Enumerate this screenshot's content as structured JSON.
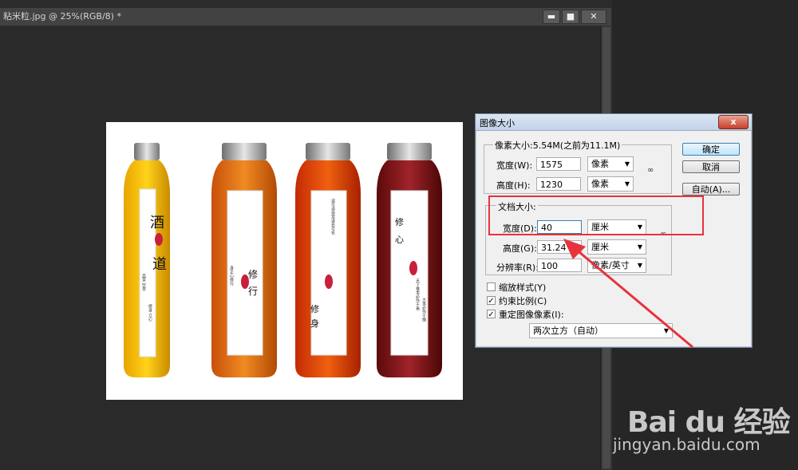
{
  "window": {
    "title": "粘米粒.jpg @ 25%(RGB/8) *",
    "min_label": "▬",
    "max_label": "■",
    "close_label": "✕"
  },
  "bottles": [
    {
      "big_chars": [
        "酒",
        "道"
      ],
      "small_lines": [
        "品茶 饮茶",
        "修身 立心"
      ]
    },
    {
      "big_chars": [
        "修",
        "行"
      ],
      "small_lines": [
        "身正心修行"
      ]
    },
    {
      "big_chars": [
        "修",
        "身"
      ],
      "small_lines": [
        "道可道非常道名可名"
      ]
    },
    {
      "big_chars": [
        "修",
        "心"
      ],
      "small_lines": [
        "天下难事必作于易",
        "大事必作于细"
      ]
    }
  ],
  "dialog": {
    "title": "图像大小",
    "close_label": "x",
    "pixel_group": {
      "legend": "像素大小:5.54M(之前为11.1M)",
      "width_label": "宽度(W):",
      "width_value": "1575",
      "width_unit": "像素",
      "height_label": "高度(H):",
      "height_value": "1230",
      "height_unit": "像素"
    },
    "doc_group": {
      "legend": "文档大小:",
      "width_label": "宽度(D):",
      "width_value": "40",
      "width_unit": "厘米",
      "height_label": "高度(G):",
      "height_value": "31.24",
      "height_unit": "厘米",
      "res_label": "分辨率(R):",
      "res_value": "100",
      "res_unit": "像素/英寸"
    },
    "buttons": {
      "ok": "确定",
      "cancel": "取消",
      "auto": "自动(A)..."
    },
    "checkboxes": {
      "scale_styles": {
        "label": "缩放样式(Y)",
        "checked": false
      },
      "constrain": {
        "label": "约束比例(C)",
        "checked": true
      },
      "resample": {
        "label": "重定图像像素(I):",
        "checked": true
      }
    },
    "resample_method": "两次立方（自动）"
  },
  "watermark": {
    "brand": "Bai du 经验",
    "url": "jingyan.baidu.com"
  },
  "colors": {
    "highlight": "#e8323c",
    "arrow": "#e8323c"
  },
  "icons": [
    "link-icon",
    "chevron-down-icon",
    "checkmark-icon"
  ]
}
